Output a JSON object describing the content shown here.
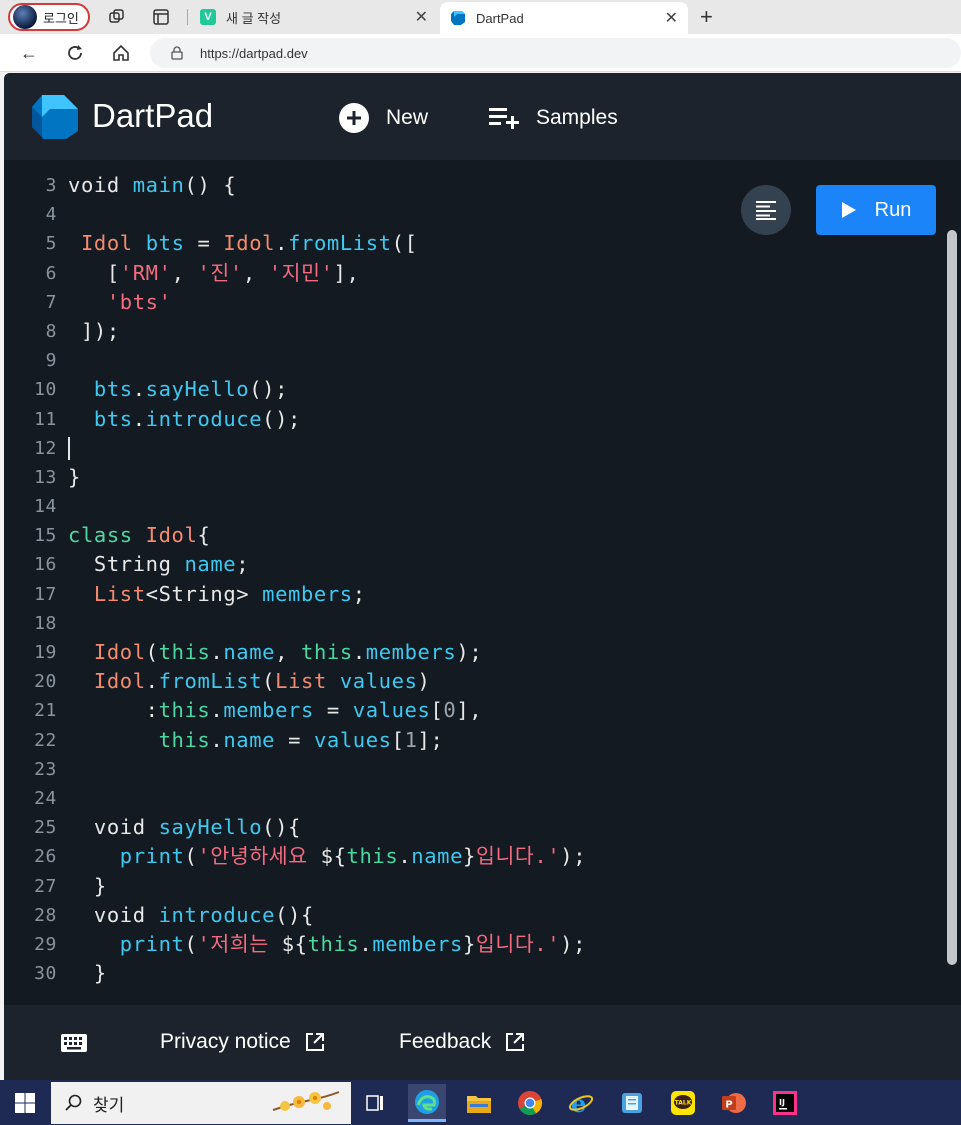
{
  "browser": {
    "profile_label": "로그인",
    "tabs": [
      {
        "title": "새 글 작성",
        "favicon": "v-icon",
        "favicon_color": "#20c997"
      },
      {
        "title": "DartPad",
        "favicon": "dart-icon",
        "favicon_color": "#0175c2"
      }
    ],
    "url": "https://dartpad.dev"
  },
  "dartpad": {
    "brand": "DartPad",
    "new_label": "New",
    "samples_label": "Samples",
    "run_label": "Run",
    "privacy_label": "Privacy notice",
    "feedback_label": "Feedback"
  },
  "editor": {
    "lines": [
      {
        "n": "3",
        "tokens": [
          [
            "kw",
            "void "
          ],
          [
            "fn",
            "main"
          ],
          [
            "kw",
            "() {"
          ]
        ]
      },
      {
        "n": "4",
        "tokens": []
      },
      {
        "n": "5",
        "tokens": [
          [
            "kw",
            " "
          ],
          [
            "ty",
            "Idol"
          ],
          [
            "kw",
            " "
          ],
          [
            "fn",
            "bts"
          ],
          [
            "kw",
            " = "
          ],
          [
            "ty",
            "Idol"
          ],
          [
            "kw",
            "."
          ],
          [
            "fn",
            "fromList"
          ],
          [
            "kw",
            "(["
          ]
        ]
      },
      {
        "n": "6",
        "tokens": [
          [
            "kw",
            "   ["
          ],
          [
            "str",
            "'RM'"
          ],
          [
            "kw",
            ", "
          ],
          [
            "str",
            "'진'"
          ],
          [
            "kw",
            ", "
          ],
          [
            "str",
            "'지민'"
          ],
          [
            "kw",
            "],"
          ]
        ]
      },
      {
        "n": "7",
        "tokens": [
          [
            "kw",
            "   "
          ],
          [
            "str",
            "'bts'"
          ]
        ]
      },
      {
        "n": "8",
        "tokens": [
          [
            "kw",
            " ]);"
          ]
        ]
      },
      {
        "n": "9",
        "tokens": []
      },
      {
        "n": "10",
        "tokens": [
          [
            "kw",
            "  "
          ],
          [
            "fn",
            "bts"
          ],
          [
            "kw",
            "."
          ],
          [
            "fn",
            "sayHello"
          ],
          [
            "kw",
            "();"
          ]
        ]
      },
      {
        "n": "11",
        "tokens": [
          [
            "kw",
            "  "
          ],
          [
            "fn",
            "bts"
          ],
          [
            "kw",
            "."
          ],
          [
            "fn",
            "introduce"
          ],
          [
            "kw",
            "();"
          ]
        ]
      },
      {
        "n": "12",
        "tokens": [],
        "cursor": true
      },
      {
        "n": "13",
        "tokens": [
          [
            "kw",
            "}"
          ]
        ]
      },
      {
        "n": "14",
        "tokens": []
      },
      {
        "n": "15",
        "tokens": [
          [
            "class",
            "class "
          ],
          [
            "ty",
            "Idol"
          ],
          [
            "kw",
            "{"
          ]
        ]
      },
      {
        "n": "16",
        "tokens": [
          [
            "kw",
            "  String "
          ],
          [
            "fn",
            "name"
          ],
          [
            "kw",
            ";"
          ]
        ]
      },
      {
        "n": "17",
        "tokens": [
          [
            "kw",
            "  "
          ],
          [
            "ty",
            "List"
          ],
          [
            "kw",
            "<String> "
          ],
          [
            "fn",
            "members"
          ],
          [
            "kw",
            ";"
          ]
        ]
      },
      {
        "n": "18",
        "tokens": []
      },
      {
        "n": "19",
        "tokens": [
          [
            "kw",
            "  "
          ],
          [
            "ty",
            "Idol"
          ],
          [
            "kw",
            "("
          ],
          [
            "this",
            "this"
          ],
          [
            "kw",
            "."
          ],
          [
            "fn",
            "name"
          ],
          [
            "kw",
            ", "
          ],
          [
            "this",
            "this"
          ],
          [
            "kw",
            "."
          ],
          [
            "fn",
            "members"
          ],
          [
            "kw",
            ");"
          ]
        ]
      },
      {
        "n": "20",
        "tokens": [
          [
            "kw",
            "  "
          ],
          [
            "ty",
            "Idol"
          ],
          [
            "kw",
            "."
          ],
          [
            "fn",
            "fromList"
          ],
          [
            "kw",
            "("
          ],
          [
            "ty",
            "List"
          ],
          [
            "kw",
            " "
          ],
          [
            "fn",
            "values"
          ],
          [
            "kw",
            ")"
          ]
        ]
      },
      {
        "n": "21",
        "tokens": [
          [
            "kw",
            "      :"
          ],
          [
            "this",
            "this"
          ],
          [
            "kw",
            "."
          ],
          [
            "fn",
            "members"
          ],
          [
            "kw",
            " = "
          ],
          [
            "fn",
            "values"
          ],
          [
            "kw",
            "["
          ],
          [
            "num",
            "0"
          ],
          [
            "kw",
            "],"
          ]
        ]
      },
      {
        "n": "22",
        "tokens": [
          [
            "kw",
            "       "
          ],
          [
            "this",
            "this"
          ],
          [
            "kw",
            "."
          ],
          [
            "fn",
            "name"
          ],
          [
            "kw",
            " = "
          ],
          [
            "fn",
            "values"
          ],
          [
            "kw",
            "["
          ],
          [
            "num",
            "1"
          ],
          [
            "kw",
            "];"
          ]
        ]
      },
      {
        "n": "23",
        "tokens": []
      },
      {
        "n": "24",
        "tokens": []
      },
      {
        "n": "25",
        "tokens": [
          [
            "kw",
            "  void "
          ],
          [
            "fn",
            "sayHello"
          ],
          [
            "kw",
            "(){"
          ]
        ]
      },
      {
        "n": "26",
        "tokens": [
          [
            "kw",
            "    "
          ],
          [
            "fn",
            "print"
          ],
          [
            "kw",
            "("
          ],
          [
            "str",
            "'안녕하세요 "
          ],
          [
            "kw",
            "${"
          ],
          [
            "this",
            "this"
          ],
          [
            "kw",
            "."
          ],
          [
            "fn",
            "name"
          ],
          [
            "kw",
            "}"
          ],
          [
            "str",
            "입니다.'"
          ],
          [
            "kw",
            ");"
          ]
        ]
      },
      {
        "n": "27",
        "tokens": [
          [
            "kw",
            "  }"
          ]
        ]
      },
      {
        "n": "28",
        "tokens": [
          [
            "kw",
            "  void "
          ],
          [
            "fn",
            "introduce"
          ],
          [
            "kw",
            "(){"
          ]
        ]
      },
      {
        "n": "29",
        "tokens": [
          [
            "kw",
            "    "
          ],
          [
            "fn",
            "print"
          ],
          [
            "kw",
            "("
          ],
          [
            "str",
            "'저희는 "
          ],
          [
            "kw",
            "${"
          ],
          [
            "this",
            "this"
          ],
          [
            "kw",
            "."
          ],
          [
            "fn",
            "members"
          ],
          [
            "kw",
            "}"
          ],
          [
            "str",
            "입니다.'"
          ],
          [
            "kw",
            ");"
          ]
        ]
      },
      {
        "n": "30",
        "tokens": [
          [
            "kw",
            "  }"
          ]
        ]
      }
    ]
  },
  "taskbar": {
    "search_placeholder": "찾기",
    "apps": [
      "task-view-icon",
      "edge-icon",
      "file-explorer-icon",
      "chrome-icon",
      "internet-explorer-icon",
      "notes-icon",
      "kakaotalk-icon",
      "powerpoint-icon",
      "intellij-icon"
    ],
    "kakao_label": "TALK"
  }
}
